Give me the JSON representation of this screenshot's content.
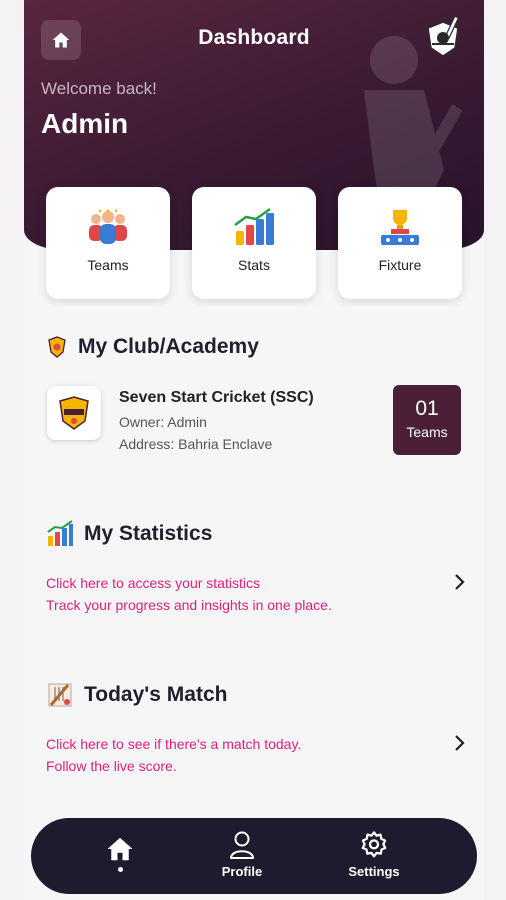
{
  "header": {
    "title": "Dashboard",
    "welcome": "Welcome back!",
    "user_name": "Admin",
    "icons": {
      "home": "home-icon",
      "logo": "cricket-club-logo"
    }
  },
  "quick_actions": [
    {
      "label": "Teams",
      "icon": "team-players-icon"
    },
    {
      "label": "Stats",
      "icon": "bar-chart-icon"
    },
    {
      "label": "Fixture",
      "icon": "trophy-podium-icon"
    }
  ],
  "club": {
    "section_title": "My Club/Academy",
    "name": "Seven Start Cricket (SSC)",
    "owner": "Owner: Admin",
    "address": "Address: Bahria Enclave",
    "teams_count": "01",
    "teams_label": "Teams"
  },
  "statistics": {
    "title": "My Statistics",
    "line1": "Click here to access your statistics",
    "line2": "Track your progress and insights in one place."
  },
  "match": {
    "title": "Today's Match",
    "line1": "Click here to see if there's a match today.",
    "line2": "Follow the live score."
  },
  "nav": [
    {
      "label": "",
      "icon": "home-icon",
      "active": true
    },
    {
      "label": "Profile",
      "icon": "user-icon"
    },
    {
      "label": "Settings",
      "icon": "gear-icon"
    }
  ],
  "colors": {
    "header": "#3a1a33",
    "accent": "#4b1f38",
    "link": "#e0207d",
    "nav": "#1e1b2e"
  }
}
